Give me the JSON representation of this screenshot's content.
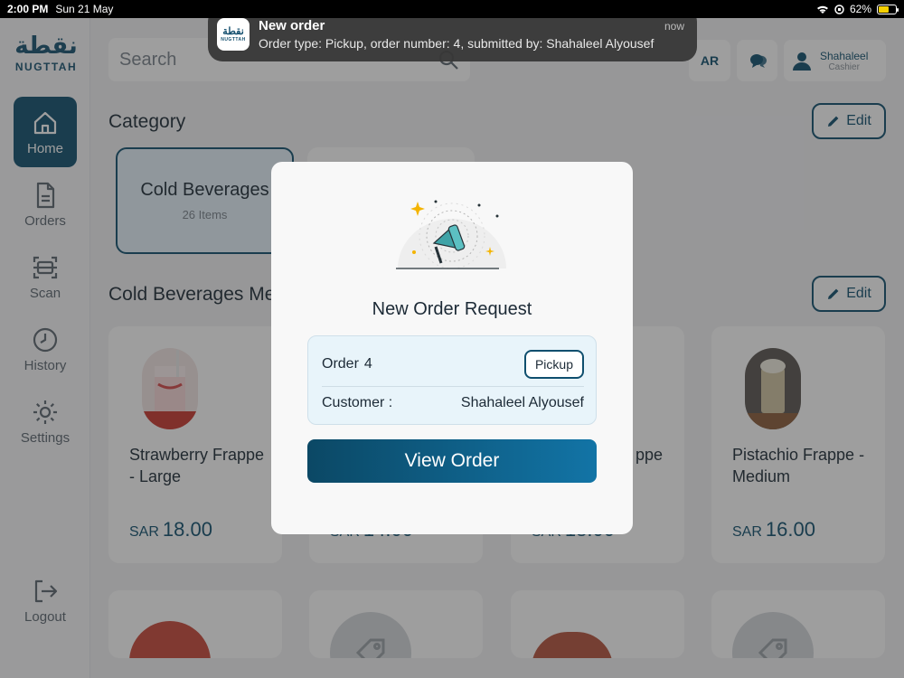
{
  "status": {
    "time": "2:00 PM",
    "date": "Sun 21 May",
    "battery": "62%",
    "battery_level": 0.62
  },
  "brand": {
    "logo_ar": "نقطة",
    "logo_en": "NUGTTAH"
  },
  "sidebar": {
    "items": [
      {
        "label": "Home",
        "icon": "home-icon"
      },
      {
        "label": "Orders",
        "icon": "document-icon"
      },
      {
        "label": "Scan",
        "icon": "scan-icon"
      },
      {
        "label": "History",
        "icon": "clock-icon"
      },
      {
        "label": "Settings",
        "icon": "gear-icon"
      }
    ],
    "logout": "Logout"
  },
  "header": {
    "search_placeholder": "Search",
    "lang": "AR",
    "user_name": "Shahaleel",
    "user_role": "Cashier"
  },
  "category": {
    "title": "Category",
    "edit": "Edit",
    "items": [
      {
        "name": "Cold Beverages",
        "count": "26 Items"
      }
    ]
  },
  "products": {
    "title": "Cold Beverages Me",
    "edit": "Edit",
    "currency": "SAR",
    "items": [
      {
        "name": "Strawberry Frappe - Large",
        "price": "18.00"
      },
      {
        "name": "",
        "price": "14.00"
      },
      {
        "name": "ppe",
        "price": "18.00"
      },
      {
        "name": "Pistachio Frappe - Medium",
        "price": "16.00"
      }
    ]
  },
  "notification": {
    "title": "New order",
    "time": "now",
    "message": "Order type: Pickup, order number: 4, submitted by: Shahaleel Alyousef"
  },
  "modal": {
    "title": "New Order Request",
    "order_label": "Order",
    "order_number": "4",
    "order_type": "Pickup",
    "customer_label": "Customer :",
    "customer_name": "Shahaleel Alyousef",
    "button": "View Order"
  },
  "colors": {
    "primary": "#0f4f6e",
    "overlay": "rgba(40,40,40,0.45)"
  }
}
